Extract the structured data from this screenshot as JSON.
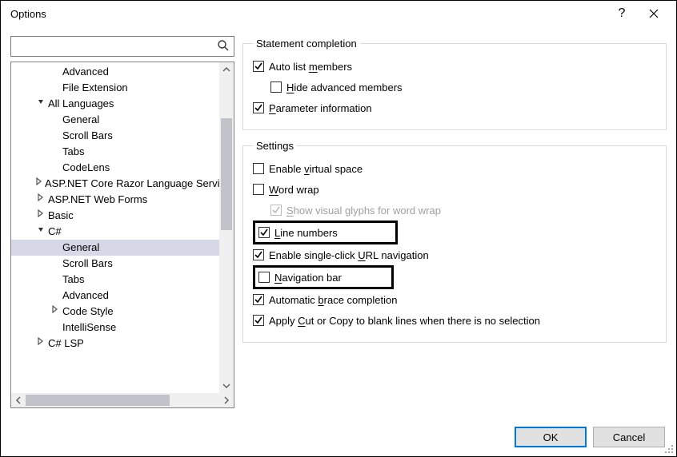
{
  "title": "Options",
  "search": {
    "placeholder": ""
  },
  "tree": {
    "items": [
      {
        "label": "Advanced",
        "indent": 2,
        "expander": ""
      },
      {
        "label": "File Extension",
        "indent": 2,
        "expander": ""
      },
      {
        "label": "All Languages",
        "indent": 1,
        "expander": "expanded"
      },
      {
        "label": "General",
        "indent": 2,
        "expander": ""
      },
      {
        "label": "Scroll Bars",
        "indent": 2,
        "expander": ""
      },
      {
        "label": "Tabs",
        "indent": 2,
        "expander": ""
      },
      {
        "label": "CodeLens",
        "indent": 2,
        "expander": ""
      },
      {
        "label": "ASP.NET Core Razor Language Service",
        "indent": 1,
        "expander": "collapsed"
      },
      {
        "label": "ASP.NET Web Forms",
        "indent": 1,
        "expander": "collapsed"
      },
      {
        "label": "Basic",
        "indent": 1,
        "expander": "collapsed"
      },
      {
        "label": "C#",
        "indent": 1,
        "expander": "expanded"
      },
      {
        "label": "General",
        "indent": 2,
        "expander": "",
        "selected": true
      },
      {
        "label": "Scroll Bars",
        "indent": 2,
        "expander": ""
      },
      {
        "label": "Tabs",
        "indent": 2,
        "expander": ""
      },
      {
        "label": "Advanced",
        "indent": 2,
        "expander": ""
      },
      {
        "label": "Code Style",
        "indent": 2,
        "expander": "collapsed"
      },
      {
        "label": "IntelliSense",
        "indent": 2,
        "expander": ""
      },
      {
        "label": "C# LSP",
        "indent": 1,
        "expander": "collapsed"
      }
    ]
  },
  "groups": {
    "statement": {
      "legend": "Statement completion",
      "auto_list_pre": "Auto list ",
      "auto_list_u": "m",
      "auto_list_post": "embers",
      "hide_pre": "",
      "hide_u": "H",
      "hide_post": "ide advanced members",
      "param_pre": "",
      "param_u": "P",
      "param_post": "arameter information"
    },
    "settings": {
      "legend": "Settings",
      "virtual_pre": "Enable ",
      "virtual_u": "v",
      "virtual_post": "irtual space",
      "wrap_pre": "",
      "wrap_u": "W",
      "wrap_post": "ord wrap",
      "glyphs_pre": "",
      "glyphs_u": "S",
      "glyphs_post": "how visual glyphs for word wrap",
      "lines_pre": "",
      "lines_u": "L",
      "lines_post": "ine numbers",
      "url_pre": "Enable single-click ",
      "url_u": "U",
      "url_post": "RL navigation",
      "nav_pre": "",
      "nav_u": "N",
      "nav_post": "avigation bar",
      "brace_pre": "Automatic ",
      "brace_u": "b",
      "brace_post": "race completion",
      "cutcopy_pre": "Apply ",
      "cutcopy_u": "C",
      "cutcopy_post": "ut or Copy to blank lines when there is no selection"
    }
  },
  "checked": {
    "auto_list": true,
    "hide": false,
    "param": true,
    "virtual": false,
    "wrap": false,
    "glyphs": true,
    "lines": true,
    "url": true,
    "nav": false,
    "brace": true,
    "cutcopy": true
  },
  "buttons": {
    "ok": "OK",
    "cancel": "Cancel"
  }
}
